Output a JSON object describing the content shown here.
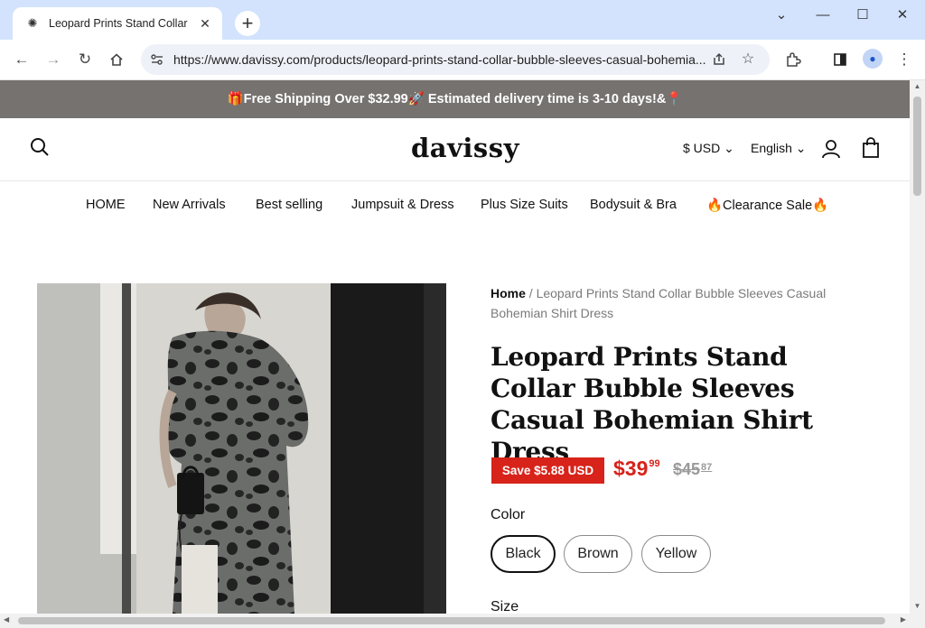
{
  "browser": {
    "tab_title": "Leopard Prints Stand Collar Bub",
    "tab_close": "✕",
    "new_tab": "+",
    "url": "https://www.davissy.com/products/leopard-prints-stand-collar-bubble-sleeves-casual-bohemia...",
    "window_controls": {
      "collapse": "⌄",
      "minimize": "—",
      "maximize": "☐",
      "close": "✕"
    }
  },
  "announcement": "🎁Free Shipping Over $32.99🚀 Estimated delivery time is 3-10 days!&📍",
  "header": {
    "logo": "davissy",
    "currency": "$ USD ⌄",
    "language": "English ⌄"
  },
  "nav": [
    {
      "label": "HOME"
    },
    {
      "label": "New Arrivals"
    },
    {
      "label": "Best selling"
    },
    {
      "label": "Jumpsuit & Dress"
    },
    {
      "label": "Plus Size Suits"
    },
    {
      "label": "Bodysuit & Bra"
    },
    {
      "label": "🔥Clearance Sale🔥"
    }
  ],
  "product": {
    "breadcrumb_home": "Home",
    "breadcrumb_sep": " / ",
    "breadcrumb_current": "Leopard Prints Stand Collar Bubble Sleeves Casual Bohemian Shirt Dress",
    "title": "Leopard Prints Stand Collar Bubble Sleeves Casual Bohemian Shirt Dress",
    "save_badge": "Save $5.88 USD",
    "price_main": "$39",
    "price_cents": "99",
    "compare_main": "$45",
    "compare_cents": "87",
    "color_label": "Color",
    "colors": [
      "Black",
      "Brown",
      "Yellow"
    ],
    "selected_color": "Black",
    "size_label": "Size"
  },
  "colors": {
    "announce_bg": "#767270",
    "sale_red": "#d7231a",
    "tab_bar": "#d3e3fd"
  }
}
